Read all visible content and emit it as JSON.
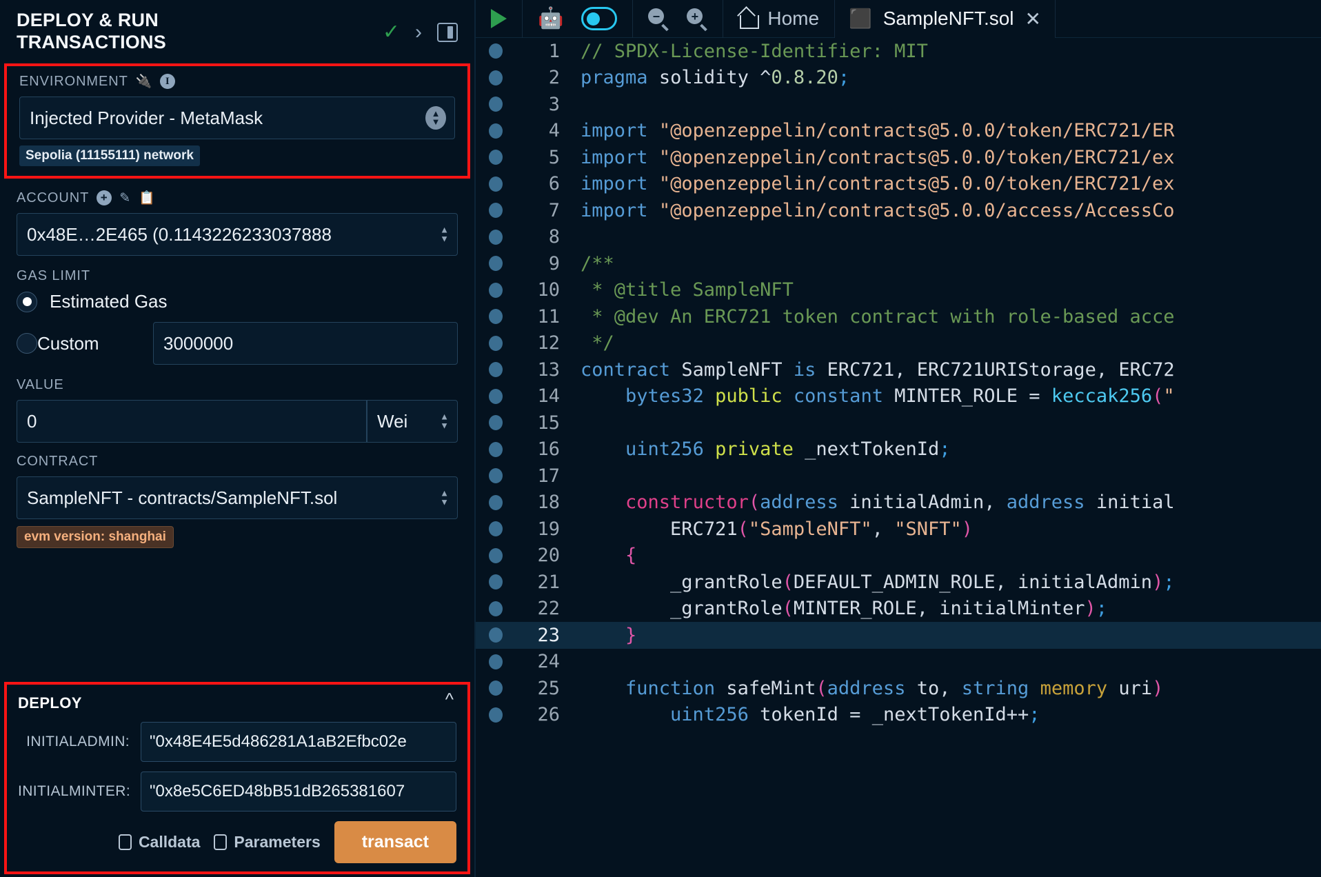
{
  "left_panel": {
    "title": "DEPLOY & RUN TRANSACTIONS",
    "head_icons": {
      "check": "✓",
      "chevron": "›",
      "layout": "panel-layout-icon"
    },
    "environment": {
      "label": "ENVIRONMENT",
      "plug_icon": "plug-icon",
      "info_icon": "i",
      "selected": "Injected Provider - MetaMask",
      "network_badge": "Sepolia (11155111) network"
    },
    "account": {
      "label": "ACCOUNT",
      "plus_icon": "+",
      "edit_icon": "edit-icon",
      "copy_icon": "copy-icon",
      "selected": "0x48E…2E465 (0.1143226233037888"
    },
    "gas_limit": {
      "label": "GAS LIMIT",
      "estimated_label": "Estimated Gas",
      "custom_label": "Custom",
      "custom_value": "3000000",
      "selected": "estimated"
    },
    "value": {
      "label": "VALUE",
      "amount": "0",
      "unit": "Wei"
    },
    "contract": {
      "label": "CONTRACT",
      "selected": "SampleNFT - contracts/SampleNFT.sol",
      "evm_badge": "evm version: shanghai"
    },
    "deploy": {
      "title": "DEPLOY",
      "collapse_icon": "chevron-up-icon",
      "params": [
        {
          "label": "INITIALADMIN:",
          "value": "\"0x48E4E5d486281A1aB2Efbc02e"
        },
        {
          "label": "INITIALMINTER:",
          "value": "\"0x8e5C6ED48bB51dB265381607"
        }
      ],
      "calldata_label": "Calldata",
      "parameters_label": "Parameters",
      "transact_label": "transact",
      "transact_color": "#d98b45"
    }
  },
  "editor": {
    "toolbar": {
      "run_icon": "play-icon",
      "ai_icon": "robot-icon",
      "ai_toggle_icon": "toggle-on-icon",
      "zoom_out_icon": "zoom-out-icon",
      "zoom_in_icon": "zoom-in-icon",
      "home_icon": "home-icon",
      "home_label": "Home"
    },
    "tab": {
      "file_icon": "solidity-icon",
      "label": "SampleNFT.sol",
      "close_icon": "✕"
    },
    "active_line": 23,
    "lines": [
      {
        "n": 1,
        "text": "// SPDX-License-Identifier: MIT"
      },
      {
        "n": 2,
        "text": "pragma solidity ^0.8.20;"
      },
      {
        "n": 3,
        "text": ""
      },
      {
        "n": 4,
        "text": "import \"@openzeppelin/contracts@5.0.0/token/ERC721/ER"
      },
      {
        "n": 5,
        "text": "import \"@openzeppelin/contracts@5.0.0/token/ERC721/ex"
      },
      {
        "n": 6,
        "text": "import \"@openzeppelin/contracts@5.0.0/token/ERC721/ex"
      },
      {
        "n": 7,
        "text": "import \"@openzeppelin/contracts@5.0.0/access/AccessCo"
      },
      {
        "n": 8,
        "text": ""
      },
      {
        "n": 9,
        "text": "/**"
      },
      {
        "n": 10,
        "text": " * @title SampleNFT"
      },
      {
        "n": 11,
        "text": " * @dev An ERC721 token contract with role-based acce"
      },
      {
        "n": 12,
        "text": " */"
      },
      {
        "n": 13,
        "text": "contract SampleNFT is ERC721, ERC721URIStorage, ERC72"
      },
      {
        "n": 14,
        "text": "    bytes32 public constant MINTER_ROLE = keccak256(\""
      },
      {
        "n": 15,
        "text": ""
      },
      {
        "n": 16,
        "text": "    uint256 private _nextTokenId;"
      },
      {
        "n": 17,
        "text": ""
      },
      {
        "n": 18,
        "text": "    constructor(address initialAdmin, address initial"
      },
      {
        "n": 19,
        "text": "        ERC721(\"SampleNFT\", \"SNFT\")"
      },
      {
        "n": 20,
        "text": "    {"
      },
      {
        "n": 21,
        "text": "        _grantRole(DEFAULT_ADMIN_ROLE, initialAdmin);"
      },
      {
        "n": 22,
        "text": "        _grantRole(MINTER_ROLE, initialMinter);"
      },
      {
        "n": 23,
        "text": "    }"
      },
      {
        "n": 24,
        "text": ""
      },
      {
        "n": 25,
        "text": "    function safeMint(address to, string memory uri)"
      },
      {
        "n": 26,
        "text": "        uint256 tokenId = _nextTokenId++;"
      }
    ]
  }
}
